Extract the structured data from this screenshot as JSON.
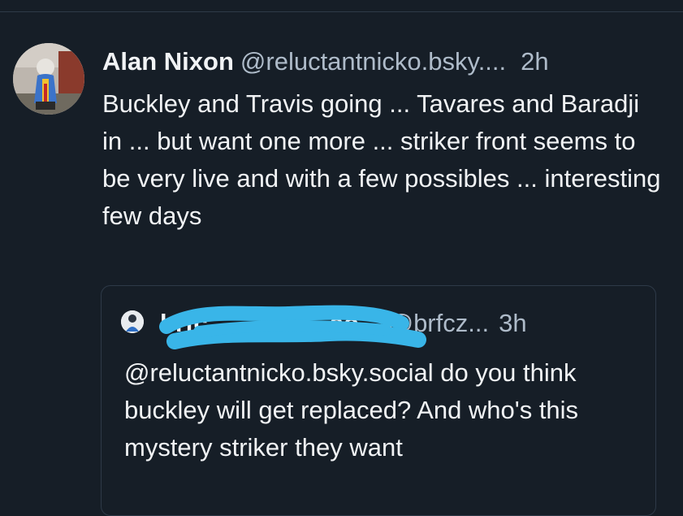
{
  "post": {
    "author_name": "Alan Nixon",
    "author_handle": "@reluctantnicko.bsky....",
    "time": "2h",
    "text": "Buckley and Travis going ... Tavares and Baradji in ... but want one more ... striker front seems to be very live and with a few possibles ... interesting few days"
  },
  "quote": {
    "author_name": "brfc",
    "author_name_suffix": "so...",
    "author_handle": "@brfcz...",
    "time": "3h",
    "text": "@reluctantnicko.bsky.social do you think buckley will get replaced? And who's this mystery striker they want"
  },
  "colors": {
    "background": "#161e27",
    "divider": "#2e3a48",
    "text_primary": "#f1f3f5",
    "text_secondary": "#aebbc9",
    "redaction": "#39b5e8"
  }
}
